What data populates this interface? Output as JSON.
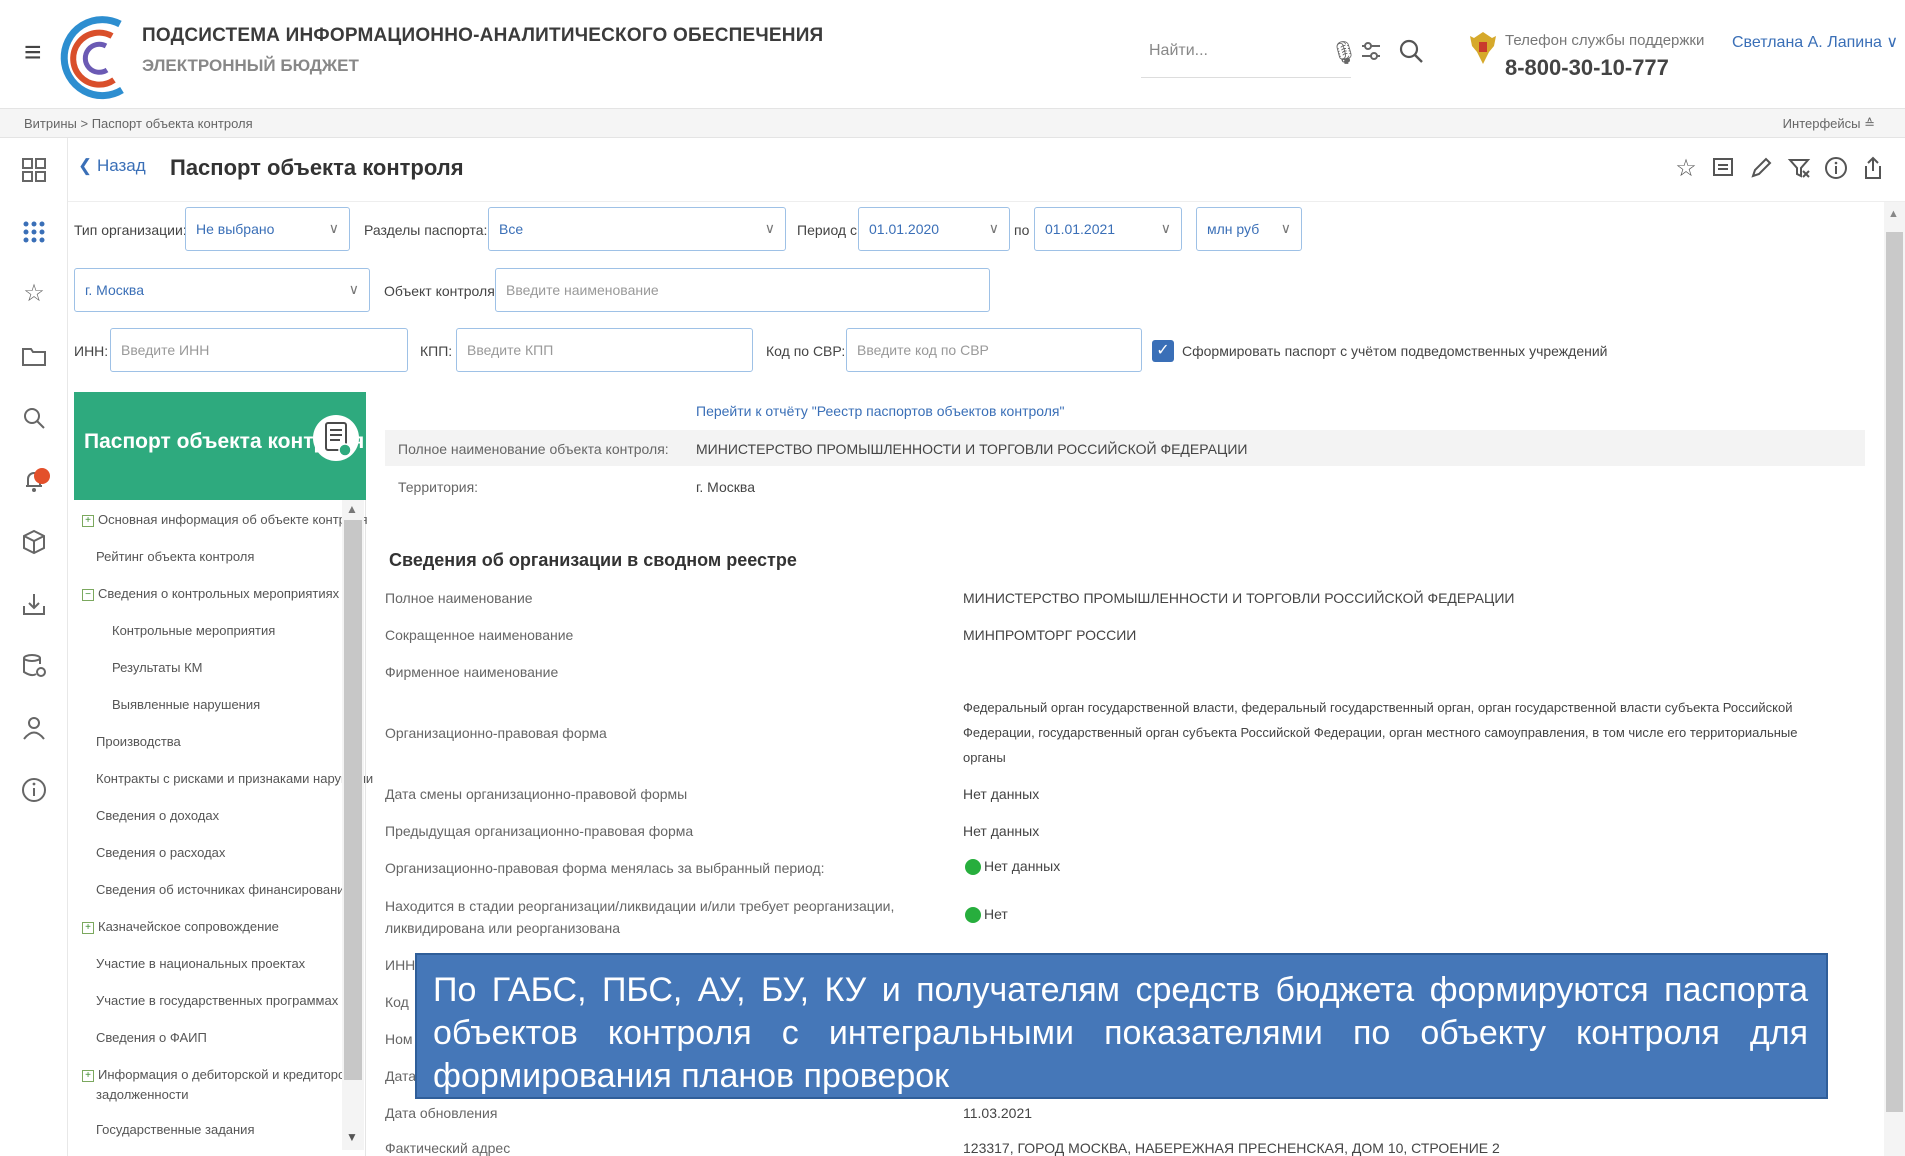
{
  "header": {
    "app_title": "ПОДСИСТЕМА ИНФОРМАЦИОННО-АНАЛИТИЧЕСКОГО ОБЕСПЕЧЕНИЯ",
    "app_subtitle": "ЭЛЕКТРОННЫЙ БЮДЖЕТ",
    "search_placeholder": "Найти...",
    "support_label": "Телефон службы поддержки",
    "support_phone": "8-800-30-10-777",
    "user_name": "Светлана А. Лапина ∨"
  },
  "breadcrumb": {
    "path": "Витрины > Паспорт объекта контроля",
    "interfaces": "Интерфейсы ≙"
  },
  "title_row": {
    "back": "❮ Назад",
    "title": "Паспорт объекта контроля"
  },
  "filters": {
    "org_type_label": "Тип организации:",
    "org_type_value": "Не выбрано",
    "sections_label": "Разделы паспорта:",
    "sections_value": "Все",
    "period_from_label": "Период с",
    "period_from_value": "01.01.2020",
    "period_to_label": "по",
    "period_to_value": "01.01.2021",
    "units_value": "млн руб",
    "region_value": "г. Москва",
    "object_label": "Объект контроля",
    "object_placeholder": "Введите наименование",
    "inn_label": "ИНН:",
    "inn_placeholder": "Введите ИНН",
    "kpp_label": "КПП:",
    "kpp_placeholder": "Введите КПП",
    "svr_label": "Код по СВР:",
    "svr_placeholder": "Введите код по СВР",
    "subordinate_label": "Сформировать паспорт с учётом подведомственных учреждений"
  },
  "passport_nav": {
    "title": "Паспорт объекта контроля",
    "items": [
      "Основная информация об объекте контроля",
      "Рейтинг объекта контроля",
      "Сведения о контрольных мероприятиях",
      "Контрольные мероприятия",
      "Результаты КМ",
      "Выявленные нарушения",
      "Производства",
      "Контракты с рисками и признаками нарушени",
      "Сведения о доходах",
      "Сведения о расходах",
      "Сведения об источниках финансирования",
      "Казначейское сопровождение",
      "Участие в национальных проектах",
      "Участие в государственных программах",
      "Сведения о ФАИП",
      "Информация о дебиторской и кредиторской",
      "задолженности",
      "Государственные задания"
    ]
  },
  "details": {
    "report_link": "Перейти к отчёту \"Реестр паспортов объектов контроля\"",
    "full_name_label": "Полное наименование объекта контроля:",
    "full_name_value": "МИНИСТЕРСТВО ПРОМЫШЛЕННОСТИ И ТОРГОВЛИ РОССИЙСКОЙ ФЕДЕРАЦИИ",
    "territory_label": "Территория:",
    "territory_value": "г. Москва",
    "section_title": "Сведения об организации в сводном реестре",
    "rows": [
      {
        "label": "Полное наименование",
        "value": "МИНИСТЕРСТВО ПРОМЫШЛЕННОСТИ И ТОРГОВЛИ РОССИЙСКОЙ ФЕДЕРАЦИИ"
      },
      {
        "label": "Сокращенное наименование",
        "value": "МИНПРОМТОРГ РОССИИ"
      },
      {
        "label": "Фирменное наименование",
        "value": ""
      },
      {
        "label": "Организационно-правовая форма",
        "value_line1": "Федеральный орган государственной власти, федеральный государственный орган, орган государственной власти субъекта Российской",
        "value_line2": "Федерации, государственный орган субъекта Российской Федерации, орган местного самоуправления, в том числе его территориальные",
        "value_line3": "органы"
      },
      {
        "label": "Дата смены организационно-правовой формы",
        "value": "Нет данных"
      },
      {
        "label": "Предыдущая организационно-правовая форма",
        "value": "Нет данных"
      },
      {
        "label": "Организационно-правовая форма менялась за выбранный период:",
        "value": "Нет данных"
      },
      {
        "label_line1": "Находится в стадии реорганизации/ликвидации и/или требует реорганизации,",
        "label_line2": "ликвидирована или реорганизована",
        "value": "Нет"
      },
      {
        "label": "ИНН",
        "value": ""
      },
      {
        "label": "Код",
        "value": ""
      },
      {
        "label": "Ном",
        "value": ""
      },
      {
        "label": "Дата",
        "value": ""
      },
      {
        "label": "Дата обновления",
        "value": "11.03.2021"
      },
      {
        "label": "Фактический адрес",
        "value": "123317, ГОРОД МОСКВА, НАБЕРЕЖНАЯ ПРЕСНЕНСКАЯ, ДОМ 10, СТРОЕНИЕ 2"
      }
    ]
  },
  "callout": {
    "text": "По ГАБС, ПБС, АУ, БУ, КУ и получателям средств бюджета формируются паспорта объектов контроля с интегральными показателями по объекту контроля для формирования планов проверок"
  },
  "colors": {
    "accent": "#3a6fb7",
    "passport_green": "#2eaa7e",
    "callout_bg": "#4577b8",
    "status_green": "#27ae3d"
  }
}
